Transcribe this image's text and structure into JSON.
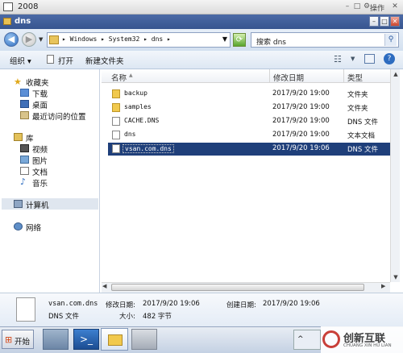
{
  "outer": {
    "title": "2008",
    "ops_label": "操作"
  },
  "window": {
    "title": "dns"
  },
  "address": {
    "path": "▸ Windows ▸ System32 ▸ dns ▸",
    "search_placeholder": "搜索 dns"
  },
  "toolbar": {
    "organize": "组织 ▾",
    "open": "打开",
    "new_folder": "新建文件夹"
  },
  "nav": {
    "favorites": "收藏夹",
    "favorites_items": [
      "下载",
      "桌面",
      "最近访问的位置"
    ],
    "library": "库",
    "library_items": [
      "视频",
      "图片",
      "文档",
      "音乐"
    ],
    "computer": "计算机",
    "network": "网络"
  },
  "columns": {
    "name": "名称",
    "sort_arrow": "▲",
    "date": "修改日期",
    "type": "类型"
  },
  "files": [
    {
      "name": "backup",
      "date": "2017/9/20 19:00",
      "type": "文件夹",
      "kind": "folder"
    },
    {
      "name": "samples",
      "date": "2017/9/20 19:00",
      "type": "文件夹",
      "kind": "folder"
    },
    {
      "name": "CACHE.DNS",
      "date": "2017/9/20 19:00",
      "type": "DNS 文件",
      "kind": "file"
    },
    {
      "name": "dns",
      "date": "2017/9/20 19:00",
      "type": "文本文档",
      "kind": "file"
    },
    {
      "name": "vsan.com.dns",
      "date": "2017/9/20 19:06",
      "type": "DNS 文件",
      "kind": "file",
      "selected": true
    }
  ],
  "details": {
    "filename": "vsan.com.dns",
    "modified_label": "修改日期:",
    "modified": "2017/9/20 19:06",
    "created_label": "创建日期:",
    "created": "2017/9/20 19:06",
    "filetype": "DNS 文件",
    "size_label": "大小:",
    "size": "482 字节"
  },
  "taskbar": {
    "start": "开始"
  },
  "watermark": {
    "text": "创新互联",
    "sub": "CHUANG XIN HU LIAN"
  },
  "colors": {
    "selection": "#1f3f7a",
    "title_bar": "#3d5c98"
  }
}
